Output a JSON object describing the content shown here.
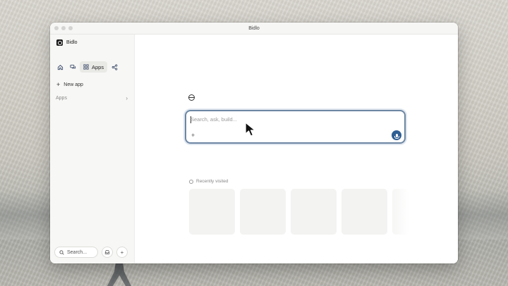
{
  "window": {
    "title": "Bidlo"
  },
  "sidebar": {
    "brand": "Bidlo",
    "nav": {
      "home_icon": "home-icon",
      "chat_icon": "chat-icon",
      "apps_icon": "apps-grid-icon",
      "apps_label": "Apps",
      "share_icon": "share-icon"
    },
    "new_app_label": "New app",
    "apps_section_label": "Apps",
    "search_label": "Search...",
    "inbox_icon": "inbox-icon",
    "add_icon": "plus-icon"
  },
  "main": {
    "prompt": {
      "placeholder": "Search, ask, build...",
      "value": ""
    },
    "recently_visited_label": "Recently visited",
    "recent_cards": 5
  },
  "colors": {
    "accent": "#2f5f93",
    "focus_border": "#6d86a3"
  }
}
